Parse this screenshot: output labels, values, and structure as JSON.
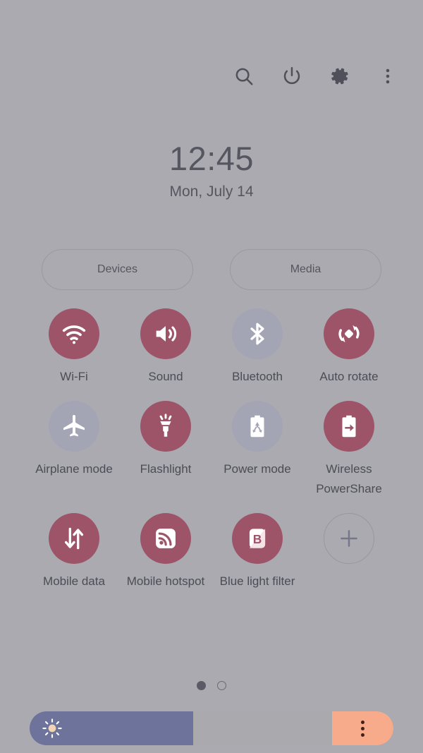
{
  "statusbar": {
    "actions": [
      {
        "name": "search-icon",
        "label": "Search"
      },
      {
        "name": "power-icon",
        "label": "Power off"
      },
      {
        "name": "gear-icon",
        "label": "Settings"
      },
      {
        "name": "more-vert-icon",
        "label": "More options"
      }
    ]
  },
  "clock": {
    "time": "12:45",
    "date": "Mon, July 14"
  },
  "pills": [
    {
      "label": "Devices"
    },
    {
      "label": "Media"
    }
  ],
  "tiles": [
    {
      "label": "Wi-Fi",
      "icon": "wifi-icon",
      "state": "on"
    },
    {
      "label": "Sound",
      "icon": "sound-icon",
      "state": "on"
    },
    {
      "label": "Bluetooth",
      "icon": "bluetooth-icon",
      "state": "off"
    },
    {
      "label": "Auto rotate",
      "icon": "auto-rotate-icon",
      "state": "on"
    },
    {
      "label": "Airplane mode",
      "icon": "airplane-icon",
      "state": "off"
    },
    {
      "label": "Flashlight",
      "icon": "flashlight-icon",
      "state": "on"
    },
    {
      "label": "Power mode",
      "icon": "power-mode-icon",
      "state": "off"
    },
    {
      "label": "Wireless PowerShare",
      "icon": "wireless-powershare-icon",
      "state": "on"
    },
    {
      "label": "Mobile data",
      "icon": "mobile-data-icon",
      "state": "on"
    },
    {
      "label": "Mobile hotspot",
      "icon": "mobile-hotspot-icon",
      "state": "on"
    },
    {
      "label": "Blue light filter",
      "icon": "blue-light-filter-icon",
      "state": "on"
    },
    {
      "label": "",
      "icon": "plus-icon",
      "state": "add"
    }
  ],
  "pagination": {
    "pages": 2,
    "current": 1
  },
  "brightness": {
    "icon": "brightness-sun-icon",
    "value_percent": 45,
    "menu_icon": "more-vert-icon"
  },
  "colors": {
    "background": "#aaaab0",
    "tile_on": "#9d5468",
    "tile_off": "#a3a4b4",
    "slider_fill": "#6d739a",
    "slider_track": "#a9a9ae",
    "slider_end": "#f8ab8a",
    "text": "#4c4c56"
  }
}
